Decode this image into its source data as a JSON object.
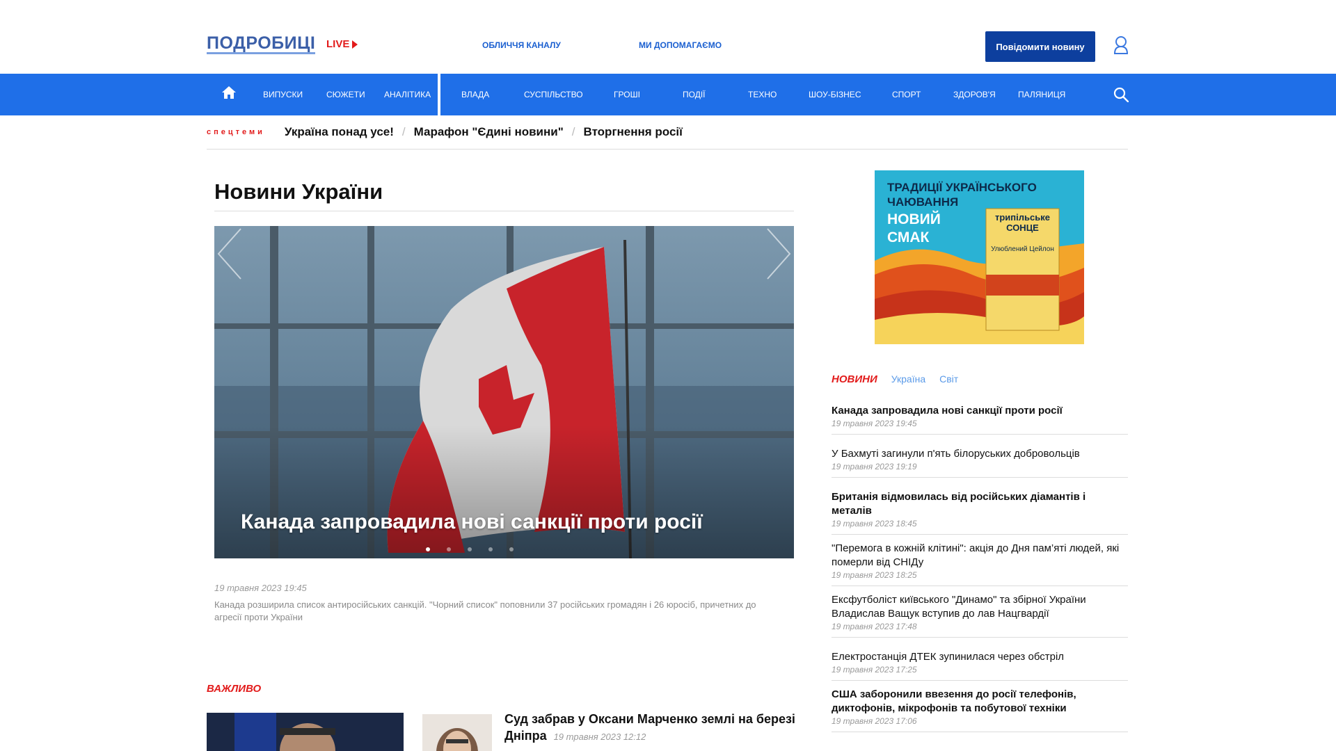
{
  "header": {
    "logo": "ПОДРОБИЦІ",
    "live": "LIVE",
    "links": [
      "ОБЛИЧЧЯ КАНАЛУ",
      "МИ ДОПОМАГАЄМО"
    ],
    "report_button": "Повідомити новину"
  },
  "nav": {
    "items_left": [
      "ВИПУСКИ",
      "СЮЖЕТИ",
      "АНАЛІТИКА"
    ],
    "items_right": [
      "ВЛАДА",
      "СУСПІЛЬСТВО",
      "ГРОШІ",
      "ПОДІЇ",
      "ТЕХНО",
      "ШОУ-БІЗНЕС",
      "СПОРТ",
      "ЗДОРОВ'Я",
      "ПАЛЯНИЦЯ"
    ]
  },
  "specthemes": {
    "label": "спецтеми",
    "items": [
      "Україна понад усе!",
      "Марафон \"Єдині новини\"",
      "Вторгнення росії"
    ]
  },
  "main": {
    "title": "Новини України",
    "hero": {
      "title": "Канада запровадила нові санкції проти росії",
      "date": "19 травня 2023 19:45",
      "description": "Канада розширила список антиросійських санкцій. \"Чорний список\" поповнили 37 російських громадян і 26 юросіб, причетних до агресії проти України",
      "slides": 5,
      "active_slide": 1
    },
    "important": {
      "label": "ВАЖЛИВО",
      "title": "Суд забрав у Оксани Марченко землі на березі Дніпра",
      "date": "19 травня 2023 12:12"
    }
  },
  "ad": {
    "line1": "ТРАДИЦІЇ УКРАЇНСЬКОГО ЧАЮВАННЯ",
    "line2": "НОВИЙ СМАК",
    "brand": "трипільське СОНЦЕ",
    "product": "Улюблений Цейлон"
  },
  "news": {
    "tabs": [
      "НОВИНИ",
      "Україна",
      "Світ"
    ],
    "items": [
      {
        "title": "Канада запровадила нові санкції проти росії",
        "date": "19 травня 2023 19:45",
        "bold": true
      },
      {
        "title": "У Бахмуті загинули п'ять білоруських добровольців",
        "date": "19 травня 2023 19:19",
        "bold": false
      },
      {
        "title": "Британія відмовилась від російських діамантів і металів",
        "date": "19 травня 2023 18:45",
        "bold": true
      },
      {
        "title": "\"Перемога в кожній клітині\": акція до Дня пам’яті людей, які померли від СНІДу",
        "date": "19 травня 2023 18:25",
        "bold": false
      },
      {
        "title": "Ексфутболіст київського \"Динамо\" та збірної України Владислав Ващук вступив до лав Нацгвардії",
        "date": "19 травня 2023 17:48",
        "bold": false
      },
      {
        "title": "Електростанція ДТЕК зупинилася через обстріл",
        "date": "19 травня 2023 17:25",
        "bold": false
      },
      {
        "title": "США заборонили ввезення до росії телефонів, диктофонів, мікрофонів та побутової техніки",
        "date": "19 травня 2023 17:06",
        "bold": true
      }
    ]
  },
  "colors": {
    "nav_blue": "#1f6fe8",
    "accent_red": "#e21b1b",
    "button_blue": "#0d3f9e",
    "logo_blue": "#3b5fa8"
  }
}
